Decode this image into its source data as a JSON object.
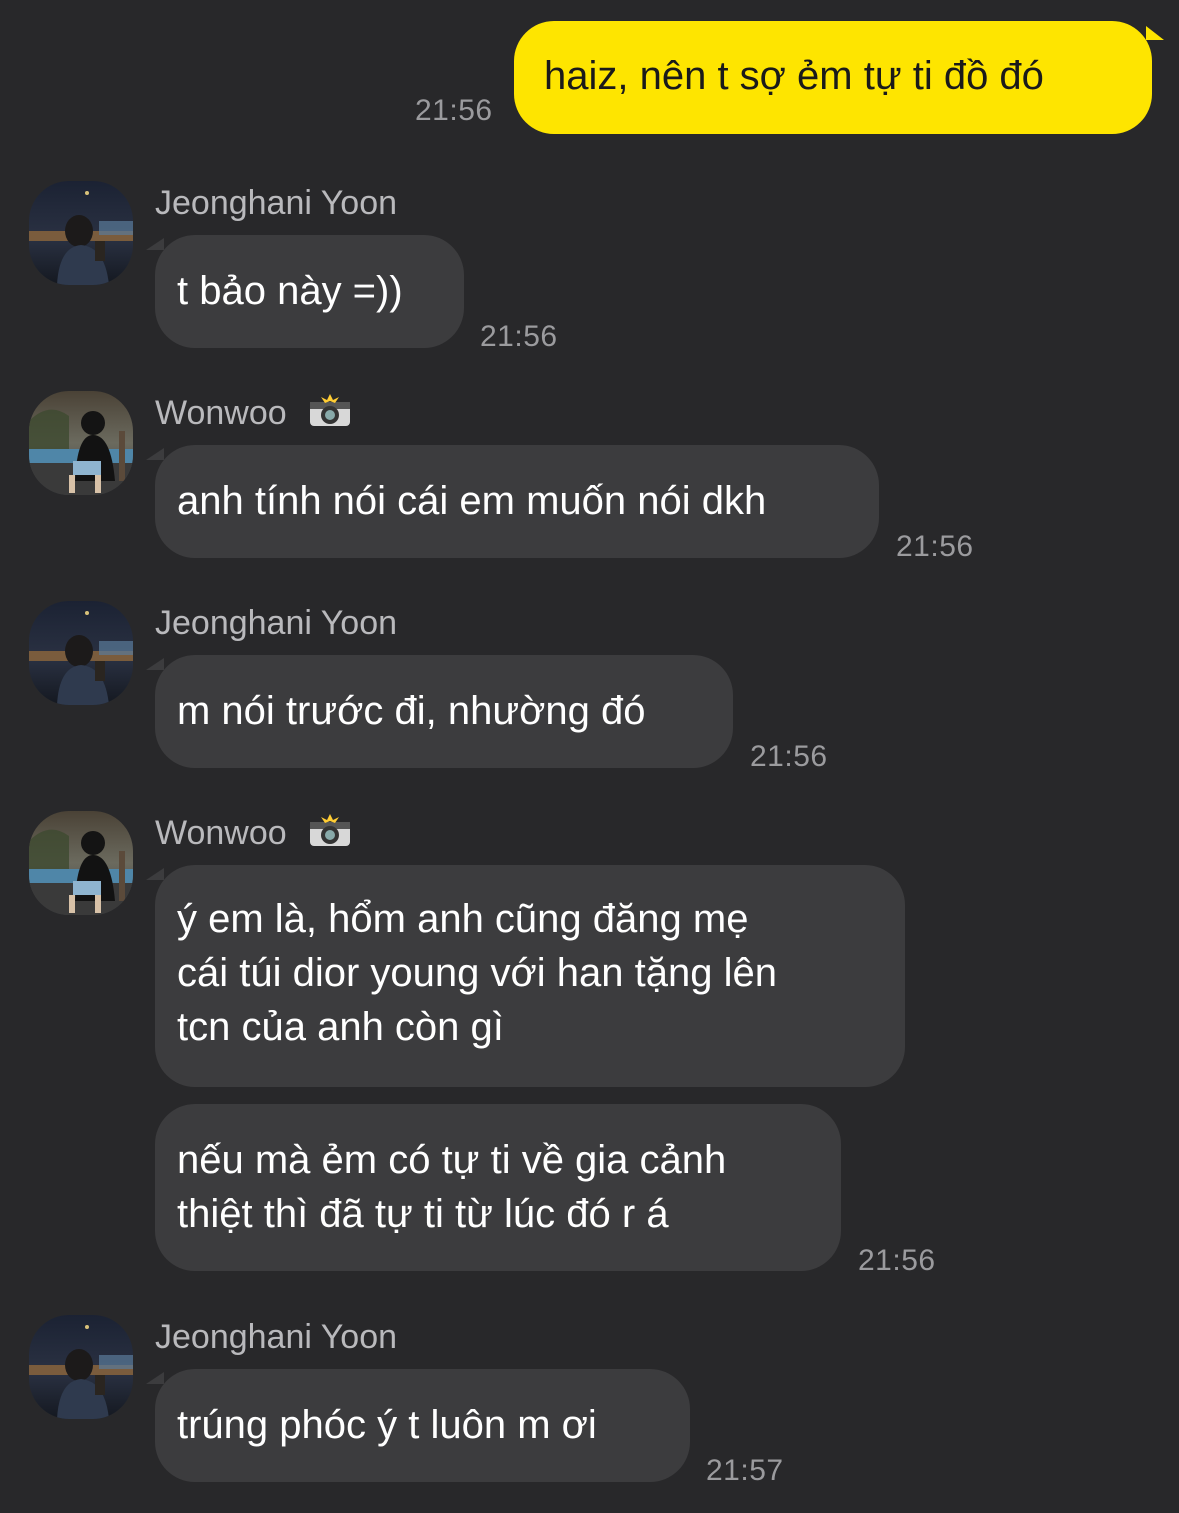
{
  "messages": [
    {
      "text": "haiz, nên t sợ ẻm tự ti đồ đó",
      "time": "21:56"
    },
    {
      "sender": "Jeonghani Yoon",
      "text": "t bảo này =))",
      "time": "21:56"
    },
    {
      "sender": "Wonwoo",
      "sender_emoji": "camera-with-flash-icon",
      "text": "anh tính nói cái em muốn nói dkh",
      "time": "21:56"
    },
    {
      "sender": "Jeonghani Yoon",
      "text": "m nói trước đi, nhường đó",
      "time": "21:56"
    },
    {
      "sender": "Wonwoo",
      "sender_emoji": "camera-with-flash-icon",
      "text": "ý em là, hổm anh cũng đăng mẹ\ncái túi dior young với han tặng lên\ntcn của anh còn gì"
    },
    {
      "text": "nếu mà ẻm có tự ti về gia cảnh\nthiệt thì đã tự ti từ lúc đó r á",
      "time": "21:56"
    },
    {
      "sender": "Jeonghani Yoon",
      "text": "trúng phóc ý t luôn m ơi",
      "time": "21:57"
    }
  ],
  "colors": {
    "background": "#28282a",
    "incoming_bubble": "#3c3c3e",
    "outgoing_bubble": "#fee500",
    "timestamp": "#9b9b9e",
    "sender_name": "#b9b9bc"
  }
}
